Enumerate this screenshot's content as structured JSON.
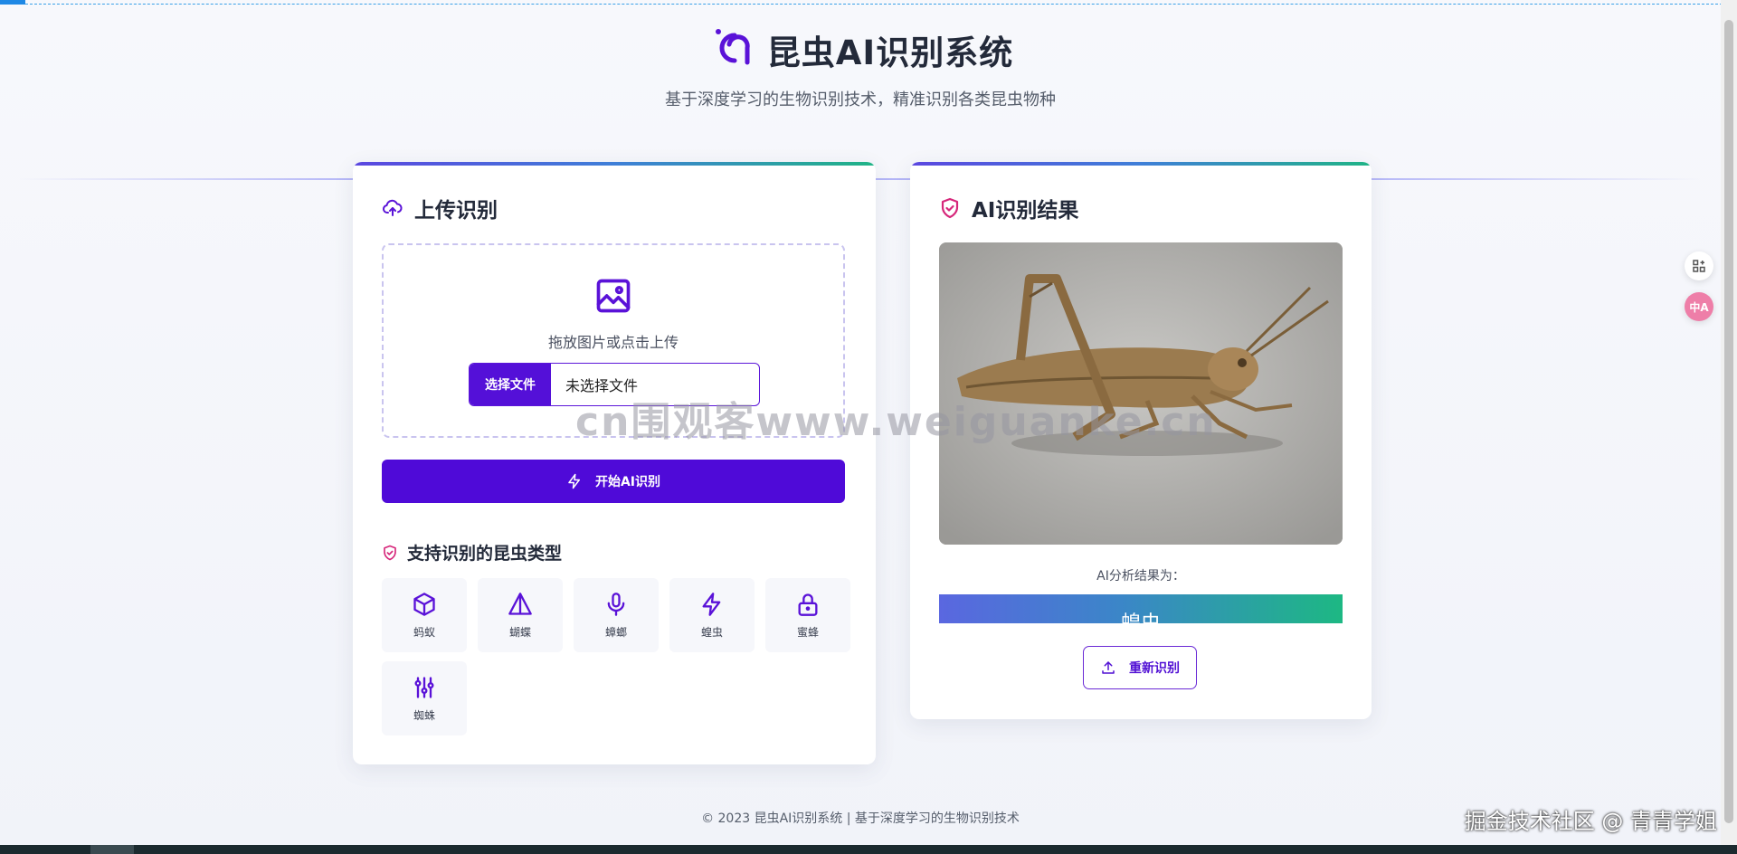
{
  "app": {
    "title": "昆虫AI识别系统",
    "subtitle": "基于深度学习的生物识别技术，精准识别各类昆虫物种"
  },
  "upload_card": {
    "title": "上传识别",
    "dropzone_hint": "拖放图片或点击上传",
    "file_button": "选择文件",
    "file_status": "未选择文件",
    "start_button": "开始AI识别",
    "types_title": "支持识别的昆虫类型",
    "insect_types": [
      {
        "label": "蚂蚁",
        "icon": "cube-icon"
      },
      {
        "label": "蝴蝶",
        "icon": "triangle-icon"
      },
      {
        "label": "蟑螂",
        "icon": "microphone-icon"
      },
      {
        "label": "蝗虫",
        "icon": "lightning-icon"
      },
      {
        "label": "蜜蜂",
        "icon": "lock-icon"
      },
      {
        "label": "蜘蛛",
        "icon": "sliders-icon"
      }
    ]
  },
  "result_card": {
    "title": "AI识别结果",
    "image_subject": "grasshopper photo",
    "result_label": "AI分析结果为：",
    "result_value": "蝗虫",
    "rerecognize_button": "重新识别"
  },
  "footer": "© 2023 昆虫AI识别系统 | 基于深度学习的生物识别技术",
  "watermarks": {
    "center": "cn围观客www.weiguanke.cn",
    "corner": "掘金技术社区 @ 青青学姐"
  },
  "side_buttons": [
    {
      "icon": "app-grid-icon"
    },
    {
      "icon": "translate-icon",
      "label": "中A"
    }
  ],
  "colors": {
    "primary": "#4f0ad8",
    "accent_gradient_start": "#5b47e0",
    "accent_gradient_end": "#20b486",
    "shield_pink": "#d6267a"
  }
}
